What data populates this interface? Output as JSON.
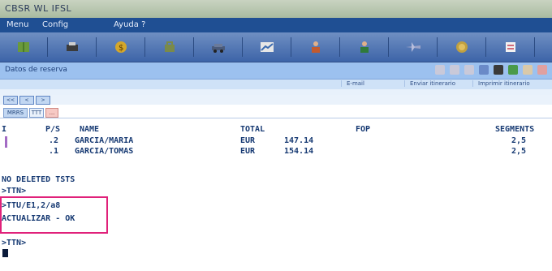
{
  "window": {
    "title": "CBSR WL IFSL"
  },
  "menubar": {
    "items": [
      "Menu",
      "Config",
      "Ayuda ?"
    ]
  },
  "toolbar": {
    "buttons": [
      {
        "icon": "book-icon",
        "color": "#6a9a3c"
      },
      {
        "icon": "printer-icon",
        "color": "#3b3b3b"
      },
      {
        "icon": "dollar-icon",
        "color": "#d4a72c"
      },
      {
        "icon": "bag-icon",
        "color": "#7a8a4a"
      },
      {
        "icon": "car-icon",
        "color": "#4a5a7a"
      },
      {
        "icon": "chart-icon",
        "color": "#d9d9d9"
      },
      {
        "icon": "person-icon",
        "color": "#c25a2e"
      },
      {
        "icon": "person-icon",
        "color": "#2f7a3a"
      },
      {
        "icon": "plane-icon",
        "color": "#9aa3c8"
      },
      {
        "icon": "coin-icon",
        "color": "#c0a040"
      },
      {
        "icon": "note-icon",
        "color": "#d06a7a"
      }
    ]
  },
  "subbar": {
    "label": "Datos de reserva"
  },
  "links": {
    "items": [
      "E-mail",
      "Enviar itinerario",
      "Imprimir itinerario"
    ]
  },
  "nav": {
    "buttons": [
      "<<",
      "<",
      ">"
    ]
  },
  "tabs": {
    "items": [
      "MRRS",
      "TTT",
      "..."
    ]
  },
  "terminal": {
    "header": {
      "col1": "I",
      "col2": "P/S",
      "col3": "NAME",
      "col4": "TOTAL",
      "col5": "FOP",
      "col6": "SEGMENTS"
    },
    "rows": [
      {
        "num": ".2",
        "name": "GARCIA/MARIA",
        "currency": "EUR",
        "amount": "147.14",
        "segments": "2,5"
      },
      {
        "num": ".1",
        "name": "GARCIA/TOMAS",
        "currency": "EUR",
        "amount": "154.14",
        "segments": "2,5"
      }
    ],
    "lines": [
      "NO DELETED TSTS",
      ">TTN>",
      ">TTU/E1,2/a8",
      "ACTUALIZAR - OK",
      ">TTN>"
    ]
  },
  "colors": {
    "highlight": "#e0217a",
    "menubar": "#1f4f93",
    "text": "#173a73"
  }
}
